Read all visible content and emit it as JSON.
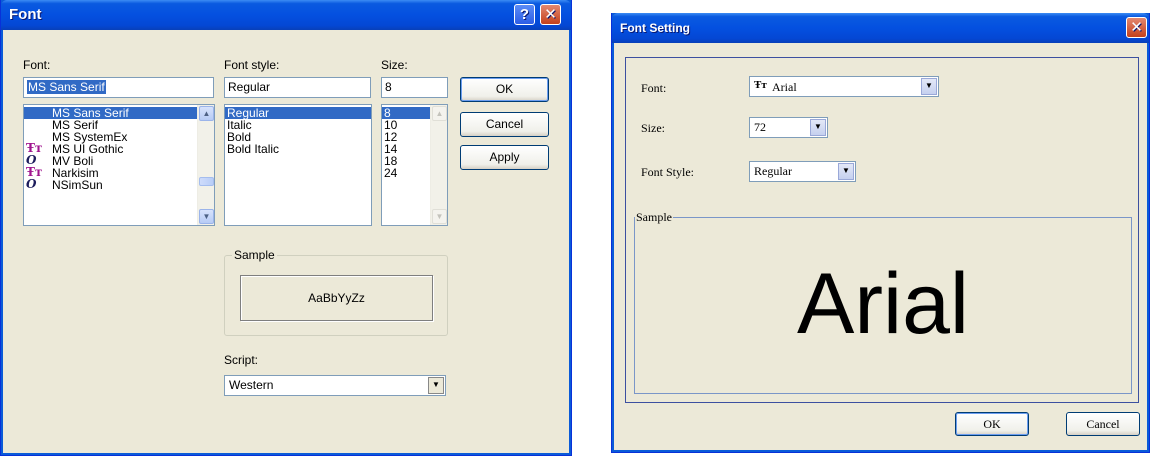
{
  "font_dialog": {
    "title": "Font",
    "help_glyph": "?",
    "close_glyph": "✕",
    "font_label": "Font:",
    "font_value": "MS Sans Serif",
    "font_list": [
      {
        "name": "MS Sans Serif",
        "icon": "",
        "selected": true
      },
      {
        "name": "MS Serif",
        "icon": "",
        "selected": false
      },
      {
        "name": "MS SystemEx",
        "icon": "",
        "selected": false
      },
      {
        "name": "MS UI Gothic",
        "icon": "truetype-icon",
        "selected": false
      },
      {
        "name": "MV Boli",
        "icon": "opentype-icon",
        "selected": false
      },
      {
        "name": "Narkisim",
        "icon": "truetype-icon",
        "selected": false
      },
      {
        "name": "NSimSun",
        "icon": "opentype-icon",
        "selected": false
      }
    ],
    "style_label": "Font style:",
    "style_value": "Regular",
    "style_list": [
      {
        "name": "Regular",
        "selected": true
      },
      {
        "name": "Italic",
        "selected": false
      },
      {
        "name": "Bold",
        "selected": false
      },
      {
        "name": "Bold Italic",
        "selected": false
      }
    ],
    "size_label": "Size:",
    "size_value": "8",
    "size_list": [
      {
        "name": "8",
        "selected": true
      },
      {
        "name": "10",
        "selected": false
      },
      {
        "name": "12",
        "selected": false
      },
      {
        "name": "14",
        "selected": false
      },
      {
        "name": "18",
        "selected": false
      },
      {
        "name": "24",
        "selected": false
      }
    ],
    "ok_label": "OK",
    "cancel_label": "Cancel",
    "apply_label": "Apply",
    "sample_label": "Sample",
    "sample_text": "AaBbYyZz",
    "script_label": "Script:",
    "script_value": "Western"
  },
  "font_setting_dialog": {
    "title": "Font Setting",
    "close_glyph": "✕",
    "font_label": "Font:",
    "font_value": "Arial",
    "size_label": "Size:",
    "size_value": "72",
    "style_label": "Font Style:",
    "style_value": "Regular",
    "sample_label": "Sample",
    "sample_text": "Arial",
    "ok_label": "OK",
    "cancel_label": "Cancel"
  },
  "icons": {
    "truetype": "Ŧᴛ",
    "opentype": "O",
    "dropdown_arrow": "▼",
    "scroll_up": "▲",
    "scroll_down": "▼"
  },
  "colors": {
    "dialog_bg": "#ece9d8",
    "title_blue": "#0450e0",
    "selection_blue": "#316ac5",
    "close_red": "#c4401c"
  }
}
